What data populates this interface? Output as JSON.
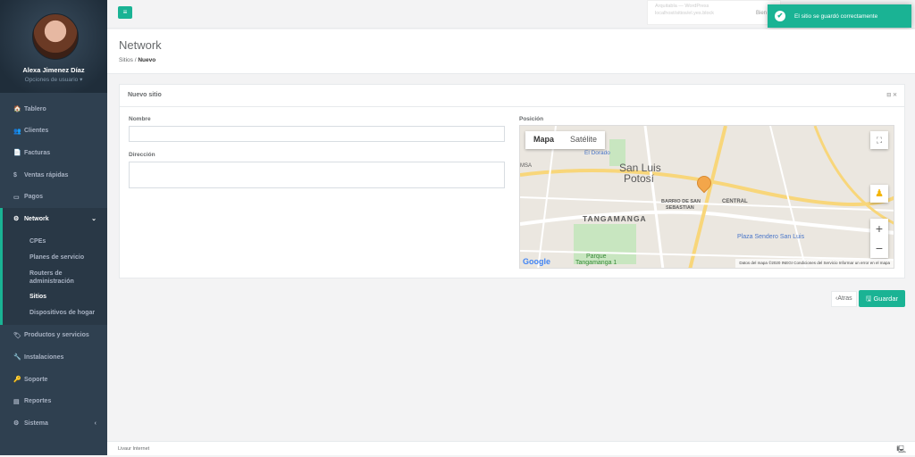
{
  "user": {
    "name": "Alexa Jimenez Díaz",
    "options": "Opciones de usuario ▾"
  },
  "menu": [
    {
      "icon": "🏠",
      "label": "Tablero"
    },
    {
      "icon": "👥",
      "label": "Clientes"
    },
    {
      "icon": "📄",
      "label": "Facturas"
    },
    {
      "icon": "$",
      "label": "Ventas rápidas"
    },
    {
      "icon": "▭",
      "label": "Pagos"
    },
    {
      "icon": "⚙",
      "label": "Network",
      "arrow": "⌄"
    }
  ],
  "submenu": [
    "CPEs",
    "Planes de servicio",
    "Routers de administración",
    "Sitios",
    "Dispositivos de hogar"
  ],
  "menu2": [
    {
      "icon": "🏷",
      "label": "Productos y servicios"
    },
    {
      "icon": "🔧",
      "label": "Instalaciones"
    },
    {
      "icon": "🔑",
      "label": "Soporte"
    },
    {
      "icon": "▤",
      "label": "Reportes"
    },
    {
      "icon": "⚙",
      "label": "Sistema",
      "arrow": "‹"
    }
  ],
  "topbar": {
    "menu_icon": "≡",
    "bg_notice_1": "Arquitabla — WordPress",
    "bg_notice_2": "localhost/sitios/el.yes.block",
    "bg_word": "Bien"
  },
  "toast": {
    "text": "El sitio se guardó correctamente",
    "icon": "✔"
  },
  "header": {
    "title": "Network",
    "breadcrumb_1": "Sitios",
    "breadcrumb_sep": "/",
    "breadcrumb_2": "Nuevo"
  },
  "panel": {
    "title": "Nuevo sitio",
    "tools": "⊟ ✕"
  },
  "form": {
    "name_label": "Nombre",
    "address_label": "Dirección",
    "position_label": "Posición"
  },
  "map": {
    "tab_map": "Mapa",
    "tab_sat": "Satélite",
    "fullscreen": "⛶",
    "zoom_in": "+",
    "zoom_out": "−",
    "labels": [
      "San Luis",
      "Potosí",
      "TANGAMANGA",
      "BARRIO DE SAN",
      "SEBASTIAN",
      "CENTRAL",
      "Plaza Sendero San Luis",
      "Parque",
      "Tangamanga 1",
      "El Dorado",
      "MSA"
    ],
    "attribution": "Datos del mapa ©2020 INEGI   Condiciones del Servicio   Informar un error en el mapa",
    "logo": "Google"
  },
  "actions": {
    "back": "‹Atras",
    "save": "🖫 Guardar"
  },
  "footer": {
    "text": "Livaur Internet",
    "icon": "🖳"
  }
}
